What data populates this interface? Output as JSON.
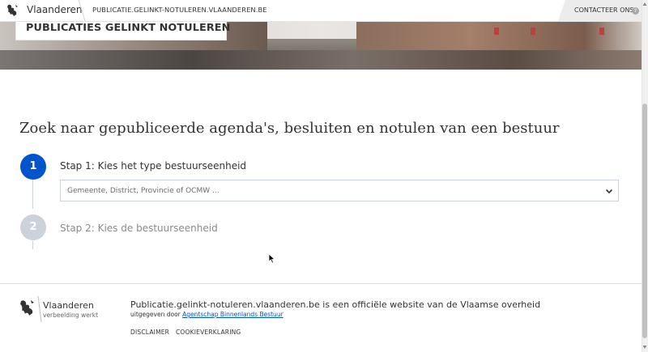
{
  "header": {
    "brand": "Vlaanderen",
    "host": "PUBLICATIE.GELINKT-NOTULEREN.VLAANDEREN.BE",
    "contact": "CONTACTEER ONS",
    "help": "?"
  },
  "hero": {
    "title": "PUBLICATIES GELINKT NOTULEREN"
  },
  "main": {
    "heading": "Zoek naar gepubliceerde agenda's, besluiten en notulen van een bestuur",
    "steps": [
      {
        "number": "1",
        "label": "Stap 1: Kies het type bestuurseenheid",
        "active": true
      },
      {
        "number": "2",
        "label": "Stap 2: Kies de bestuurseenheid",
        "active": false
      }
    ],
    "select_placeholder": "Gemeente, District, Provincie of OCMW ..."
  },
  "footer": {
    "brand": "Vlaanderen",
    "tagline": "verbeelding werkt",
    "statement": "Publicatie.gelinkt-notuleren.vlaanderen.be is een officiële website van de Vlaamse overheid",
    "published_by_prefix": "uitgegeven door",
    "published_by_link": "Agentschap Binnenlands Bestuur",
    "links": [
      "DISCLAIMER",
      "COOKIEVERKLARING"
    ]
  },
  "colors": {
    "primary": "#0055cc",
    "inactive_step": "#cbd2da",
    "text": "#333332"
  }
}
